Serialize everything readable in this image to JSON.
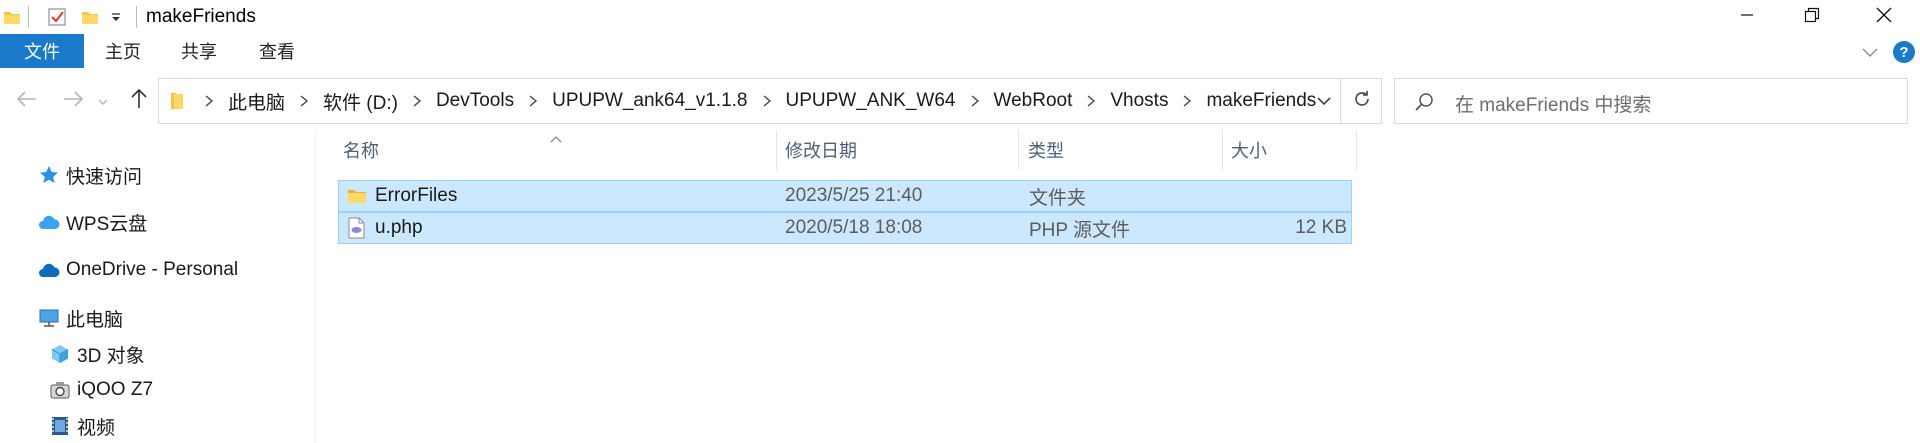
{
  "window": {
    "title": "makeFriends",
    "controls": {
      "minimize": "minimize-icon",
      "maximize": "restore-icon",
      "close": "close-icon"
    }
  },
  "ribbon": {
    "tabs": [
      "文件",
      "主页",
      "共享",
      "查看"
    ],
    "accent": "#1979ca",
    "help_label": "?"
  },
  "address": {
    "crumbs": [
      "此电脑",
      "软件 (D:)",
      "DevTools",
      "UPUPW_ank64_v1.1.8",
      "UPUPW_ANK_W64",
      "WebRoot",
      "Vhosts",
      "makeFriends"
    ]
  },
  "search": {
    "placeholder": "在 makeFriends 中搜索"
  },
  "navpane": {
    "items": [
      {
        "label": "快速访问",
        "icon": "star-icon"
      },
      {
        "label": "WPS云盘",
        "icon": "cloud-icon"
      },
      {
        "label": "OneDrive - Personal",
        "icon": "onedrive-icon"
      },
      {
        "label": "此电脑",
        "icon": "computer-icon"
      },
      {
        "label": "3D 对象",
        "icon": "cube-icon"
      },
      {
        "label": "iQOO Z7",
        "icon": "phone-camera-icon"
      },
      {
        "label": "视频",
        "icon": "video-icon"
      }
    ]
  },
  "filelist": {
    "columns": [
      "名称",
      "修改日期",
      "类型",
      "大小"
    ],
    "rows": [
      {
        "name": "ErrorFiles",
        "date": "2023/5/25 21:40",
        "type": "文件夹",
        "size": "",
        "icon": "folder-icon"
      },
      {
        "name": "u.php",
        "date": "2020/5/18 18:08",
        "type": "PHP 源文件",
        "size": "12 KB",
        "icon": "php-file-icon"
      }
    ],
    "selection_color": "#cce8ff"
  }
}
